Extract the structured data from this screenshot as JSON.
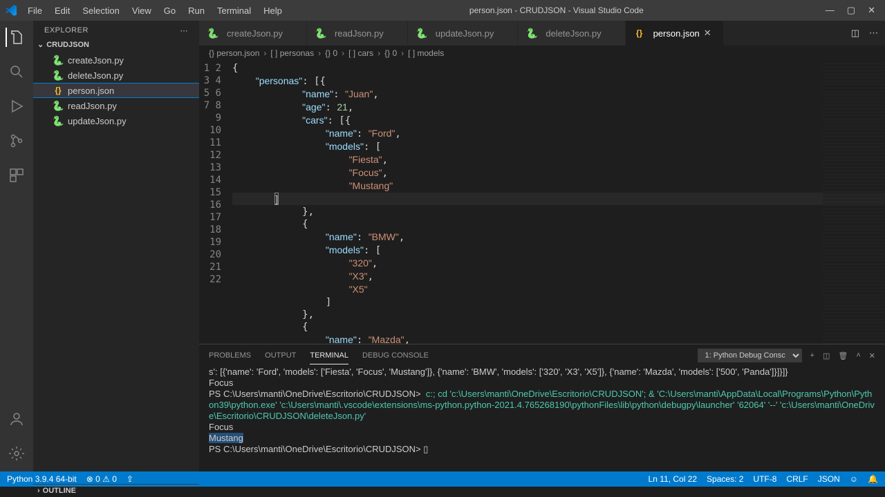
{
  "title": "person.json - CRUDJSON - Visual Studio Code",
  "menu": [
    "File",
    "Edit",
    "Selection",
    "View",
    "Go",
    "Run",
    "Terminal",
    "Help"
  ],
  "explorer": {
    "label": "EXPLORER",
    "project": "CRUDJSON",
    "files": [
      {
        "name": "createJson.py",
        "icon": "py"
      },
      {
        "name": "deleteJson.py",
        "icon": "py"
      },
      {
        "name": "person.json",
        "icon": "json",
        "selected": true
      },
      {
        "name": "readJson.py",
        "icon": "py"
      },
      {
        "name": "updateJson.py",
        "icon": "py"
      }
    ],
    "outline": "OUTLINE"
  },
  "tabs": [
    {
      "label": "createJson.py",
      "icon": "py"
    },
    {
      "label": "readJson.py",
      "icon": "py"
    },
    {
      "label": "updateJson.py",
      "icon": "py"
    },
    {
      "label": "deleteJson.py",
      "icon": "py"
    },
    {
      "label": "person.json",
      "icon": "json",
      "active": true
    }
  ],
  "breadcrumb": [
    "{} person.json",
    "[ ] personas",
    "{} 0",
    "[ ] cars",
    "{} 0",
    "[ ] models"
  ],
  "code_lines": [
    "{",
    "    \"personas\": [{",
    "            \"name\": \"Juan\",",
    "            \"age\": 21,",
    "            \"cars\": [{",
    "                \"name\": \"Ford\",",
    "                \"models\": [",
    "                    \"Fiesta\",",
    "                    \"Focus\",",
    "                    \"Mustang\"",
    "                ]",
    "            },",
    "            {",
    "                \"name\": \"BMW\",",
    "                \"models\": [",
    "                    \"320\",",
    "                    \"X3\",",
    "                    \"X5\"",
    "                ]",
    "            },",
    "            {",
    "                \"name\": \"Mazda\","
  ],
  "panel": {
    "tabs": [
      "PROBLEMS",
      "OUTPUT",
      "TERMINAL",
      "DEBUG CONSOLE"
    ],
    "select": "1: Python Debug Consc",
    "lines": [
      {
        "t": "plain",
        "v": "s': [{'name': 'Ford', 'models': ['Fiesta', 'Focus', 'Mustang']}, {'name': 'BMW', 'models': ['320', 'X3', 'X5']}, {'name': 'Mazda', 'models': ['500', 'Panda']}]}]}"
      },
      {
        "t": "plain",
        "v": "Focus"
      },
      {
        "t": "cmd",
        "prompt": "PS C:\\Users\\manti\\OneDrive\\Escritorio\\CRUDJSON> ",
        "v": "c:; cd 'c:\\Users\\manti\\OneDrive\\Escritorio\\CRUDJSON'; & 'C:\\Users\\manti\\AppData\\Local\\Programs\\Python\\Python39\\python.exe' 'c:\\Users\\manti\\.vscode\\extensions\\ms-python.python-2021.4.765268190\\pythonFiles\\lib\\python\\debugpy\\launcher' '62064' '--' 'c:\\Users\\manti\\OneDrive\\Escritorio\\CRUDJSON\\deleteJson.py'"
      },
      {
        "t": "plain",
        "v": "Focus"
      },
      {
        "t": "hl",
        "v": "Mustang"
      },
      {
        "t": "prompt",
        "prompt": "PS C:\\Users\\manti\\OneDrive\\Escritorio\\CRUDJSON> ",
        "v": "▯"
      }
    ]
  },
  "status": {
    "left": [
      "Python 3.9.4 64-bit",
      "⊗ 0 ⚠ 0"
    ],
    "right": [
      "Ln 11, Col 22",
      "Spaces: 2",
      "UTF-8",
      "CRLF",
      "JSON"
    ]
  }
}
